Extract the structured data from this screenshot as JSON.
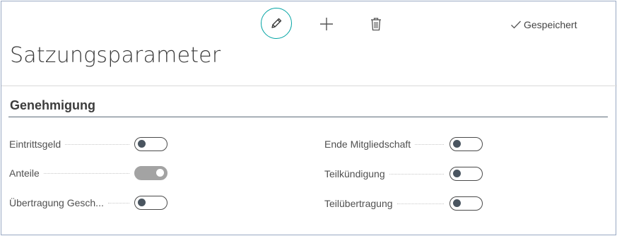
{
  "toolbar": {
    "edit_icon": "pencil-icon",
    "add_icon": "plus-icon",
    "delete_icon": "trash-icon",
    "accent_color": "#00a3a3",
    "status_label": "Gespeichert"
  },
  "page": {
    "title": "Satzungsparameter"
  },
  "section": {
    "title": "Genehmigung",
    "fields_left": [
      {
        "label": "Eintrittsgeld",
        "value": false
      },
      {
        "label": "Anteile",
        "value": true
      },
      {
        "label": "Übertragung Gesch...",
        "value": false
      }
    ],
    "fields_right": [
      {
        "label": "Ende Mitgliedschaft",
        "value": false
      },
      {
        "label": "Teilkündigung",
        "value": false
      },
      {
        "label": "Teilübertragung",
        "value": false
      }
    ]
  }
}
